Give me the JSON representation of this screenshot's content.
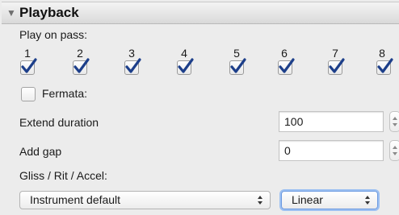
{
  "section": {
    "title": "Playback",
    "expanded_icon": "disclosure-triangle-down-icon"
  },
  "play_on_pass": {
    "label": "Play on pass:",
    "passes": [
      {
        "number": "1",
        "checked": true
      },
      {
        "number": "2",
        "checked": true
      },
      {
        "number": "3",
        "checked": true
      },
      {
        "number": "4",
        "checked": true
      },
      {
        "number": "5",
        "checked": true
      },
      {
        "number": "6",
        "checked": true
      },
      {
        "number": "7",
        "checked": true
      },
      {
        "number": "8",
        "checked": true
      }
    ]
  },
  "fermata": {
    "label": "Fermata:",
    "checked": false
  },
  "extend_duration": {
    "label": "Extend duration",
    "value": "100"
  },
  "add_gap": {
    "label": "Add gap",
    "value": "0"
  },
  "gliss": {
    "label": "Gliss / Rit / Accel:",
    "instrument_select": "Instrument default",
    "curve_select": "Linear"
  },
  "colors": {
    "checkmark": "#1d3f8a",
    "header_gradient_top": "#f4f4f4",
    "header_gradient_bottom": "#d9d9d9",
    "focus_ring": "#9cc0f2"
  }
}
